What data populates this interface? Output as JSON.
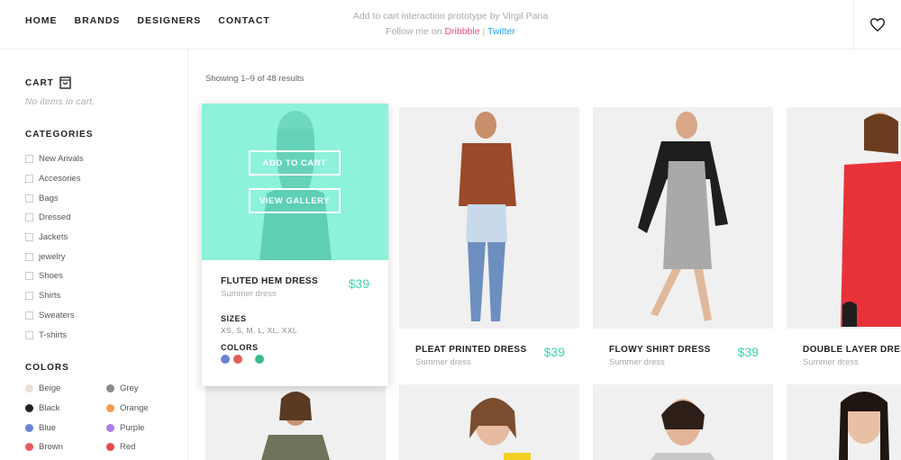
{
  "nav": {
    "items": [
      "HOME",
      "BRANDS",
      "DESIGNERS",
      "CONTACT"
    ]
  },
  "credit": {
    "line1": "Add to cart interaction prototype by Virgil Pana",
    "follow": "Follow me on",
    "dribbble": "Dribbble",
    "separator": "|",
    "twitter": "Twitter"
  },
  "header": {
    "favorite_icon": "heart-icon"
  },
  "sidebar": {
    "cart_title": "CART",
    "cart_icon": "shopping-bag-icon",
    "cart_empty": "No items in cart.",
    "categories_title": "CATEGORIES",
    "categories": [
      "New Arivals",
      "Accesories",
      "Bags",
      "Dressed",
      "Jackets",
      "jewelry",
      "Shoes",
      "Shirts",
      "Sweaters",
      "T-shirts"
    ],
    "colors_title": "COLORS",
    "colors": [
      {
        "name": "Beige",
        "hex": "#e9ddd4"
      },
      {
        "name": "Grey",
        "hex": "#8a8a8a"
      },
      {
        "name": "Black",
        "hex": "#222222"
      },
      {
        "name": "Orange",
        "hex": "#f59b4e"
      },
      {
        "name": "Blue",
        "hex": "#6b82d6"
      },
      {
        "name": "Purple",
        "hex": "#b07ae8"
      },
      {
        "name": "Brown",
        "hex": "#e85b5b"
      },
      {
        "name": "Red",
        "hex": "#e84b4b"
      }
    ]
  },
  "main": {
    "results_text": "Showing 1–9 of 48 results",
    "featured": {
      "add_to_cart": "ADD TO CART",
      "view_gallery": "VIEW GALLERY",
      "name": "FLUTED HEM DRESS",
      "subtitle": "Summer dress",
      "price": "$39",
      "sizes_label": "SIZES",
      "sizes": "XS, S, M, L, XL, XXL",
      "colors_label": "COLORS",
      "swatches": [
        "#6b82d6",
        "#e85b5b",
        "#3dba8a"
      ]
    },
    "products": [
      {
        "name": "PLEAT PRINTED DRESS",
        "subtitle": "Summer dress",
        "price": "$39"
      },
      {
        "name": "FLOWY SHIRT DRESS",
        "subtitle": "Summer dress",
        "price": "$39"
      },
      {
        "name": "DOUBLE LAYER DRESS",
        "subtitle": "Summer dress",
        "price": ""
      }
    ]
  },
  "accent": "#3dd6b1"
}
